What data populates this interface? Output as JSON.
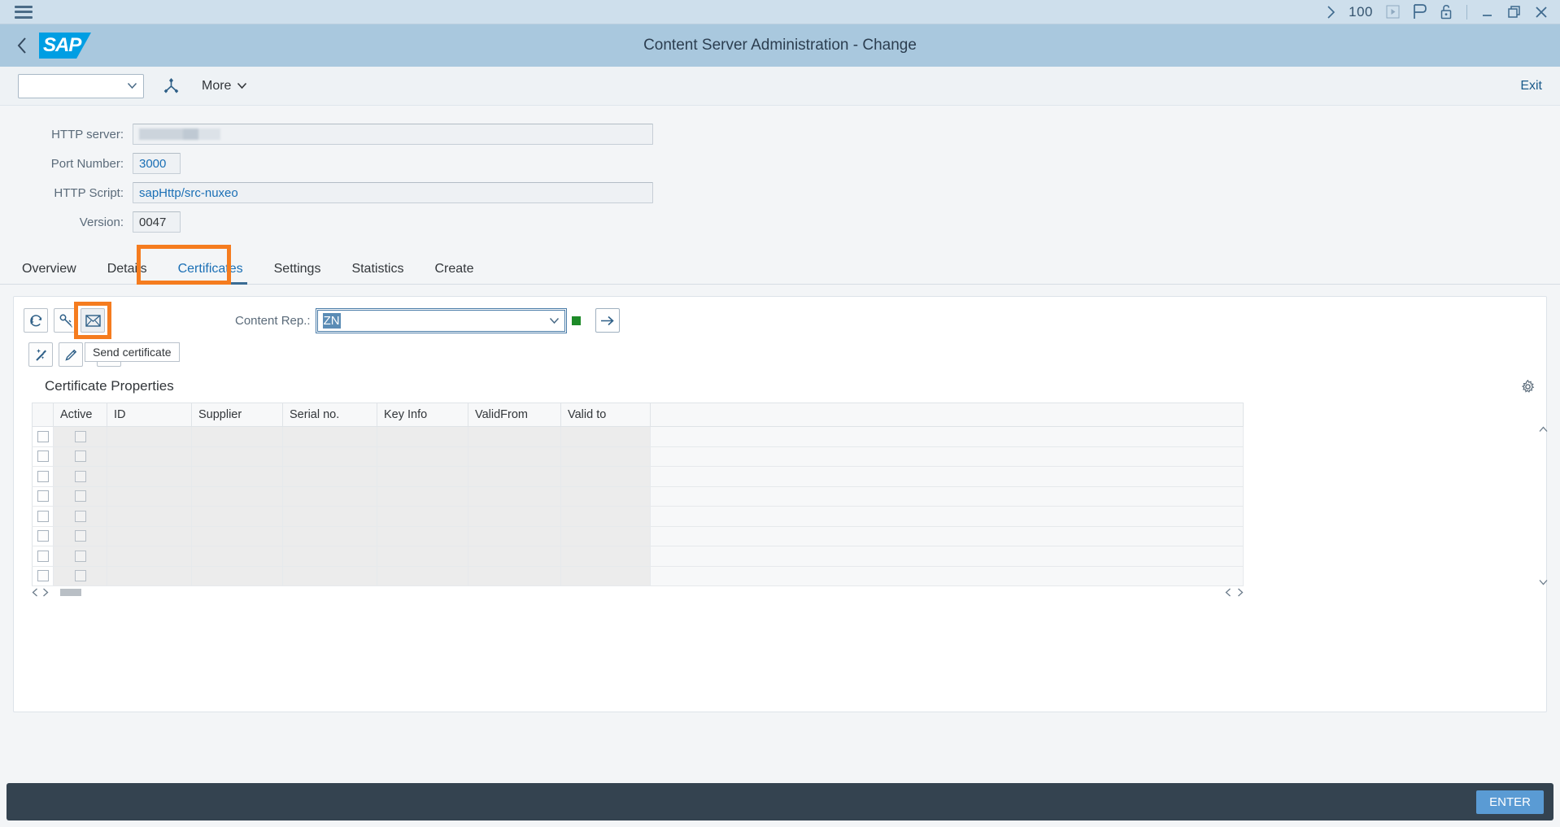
{
  "window": {
    "menu_icon": "hamburger-icon",
    "forward_icon": "chevron-right-icon",
    "session_number": "100",
    "play_icon": "play-square-icon",
    "personalize_icon": "p-flag-icon",
    "lock_icon": "unlocked-padlock-icon",
    "minimize_icon": "minimize-icon",
    "restore_icon": "restore-window-icon",
    "close_icon": "close-x-icon"
  },
  "shell": {
    "back_icon": "back-chevron-icon",
    "logo_text": "SAP",
    "title": "Content Server Administration - Change"
  },
  "toolbar": {
    "select_value": "",
    "select_chevron": "chevron-down-icon",
    "share_icon": "branch-share-icon",
    "more_label": "More",
    "more_chevron": "chevron-down-icon",
    "exit_label": "Exit"
  },
  "form": {
    "fields": [
      {
        "label": "HTTP server:",
        "value": "",
        "redacted": true
      },
      {
        "label": "Port Number:",
        "value": "3000",
        "redacted": false
      },
      {
        "label": "HTTP Script:",
        "value": "sapHttp/src-nuxeo",
        "redacted": false
      },
      {
        "label": "Version:",
        "value": "0047",
        "redacted": false
      }
    ]
  },
  "tabs": {
    "items": [
      {
        "label": "Overview"
      },
      {
        "label": "Details"
      },
      {
        "label": "Certificates"
      },
      {
        "label": "Settings"
      },
      {
        "label": "Statistics"
      },
      {
        "label": "Create"
      }
    ],
    "active_index": 2,
    "highlight_color": "#f57c1f"
  },
  "certificates": {
    "toolbar_row1": [
      {
        "name": "refresh-icon",
        "tooltip": ""
      },
      {
        "name": "key-edit-icon",
        "tooltip": ""
      },
      {
        "name": "envelope-icon",
        "tooltip": "Send certificate",
        "highlighted": true
      }
    ],
    "tooltip_text": "Send certificate",
    "content_rep_label": "Content Rep.:",
    "content_rep_value": "ZN",
    "content_rep_chevron": "chevron-down-icon",
    "status_color": "#1d8a28",
    "go_icon": "arrow-right-icon",
    "toolbar_row2": [
      {
        "name": "magic-wand-icon"
      },
      {
        "name": "pencil-edit-icon"
      },
      {
        "name": "trash-delete-icon"
      }
    ],
    "section_title": "Certificate Properties",
    "settings_icon": "gear-icon",
    "columns": [
      "",
      "Active",
      "ID",
      "Supplier",
      "Serial no.",
      "Key Info",
      "ValidFrom",
      "Valid to",
      ""
    ],
    "row_count": 8,
    "rows": [
      {
        "select": false,
        "active": false,
        "id": "",
        "supplier": "",
        "serial_no": "",
        "key_info": "",
        "valid_from": "",
        "valid_to": ""
      },
      {
        "select": false,
        "active": false,
        "id": "",
        "supplier": "",
        "serial_no": "",
        "key_info": "",
        "valid_from": "",
        "valid_to": ""
      },
      {
        "select": false,
        "active": false,
        "id": "",
        "supplier": "",
        "serial_no": "",
        "key_info": "",
        "valid_from": "",
        "valid_to": ""
      },
      {
        "select": false,
        "active": false,
        "id": "",
        "supplier": "",
        "serial_no": "",
        "key_info": "",
        "valid_from": "",
        "valid_to": ""
      },
      {
        "select": false,
        "active": false,
        "id": "",
        "supplier": "",
        "serial_no": "",
        "key_info": "",
        "valid_from": "",
        "valid_to": ""
      },
      {
        "select": false,
        "active": false,
        "id": "",
        "supplier": "",
        "serial_no": "",
        "key_info": "",
        "valid_from": "",
        "valid_to": ""
      },
      {
        "select": false,
        "active": false,
        "id": "",
        "supplier": "",
        "serial_no": "",
        "key_info": "",
        "valid_from": "",
        "valid_to": ""
      },
      {
        "select": false,
        "active": false,
        "id": "",
        "supplier": "",
        "serial_no": "",
        "key_info": "",
        "valid_from": "",
        "valid_to": ""
      }
    ],
    "scroll_up_icon": "scroll-up-icon",
    "scroll_down_icon": "scroll-down-icon",
    "scroll_left_icon": "scroll-left-icon",
    "scroll_right_icon": "scroll-right-icon"
  },
  "footer": {
    "enter_label": "ENTER",
    "background": "#344350",
    "button_color": "#5a9bd4"
  }
}
